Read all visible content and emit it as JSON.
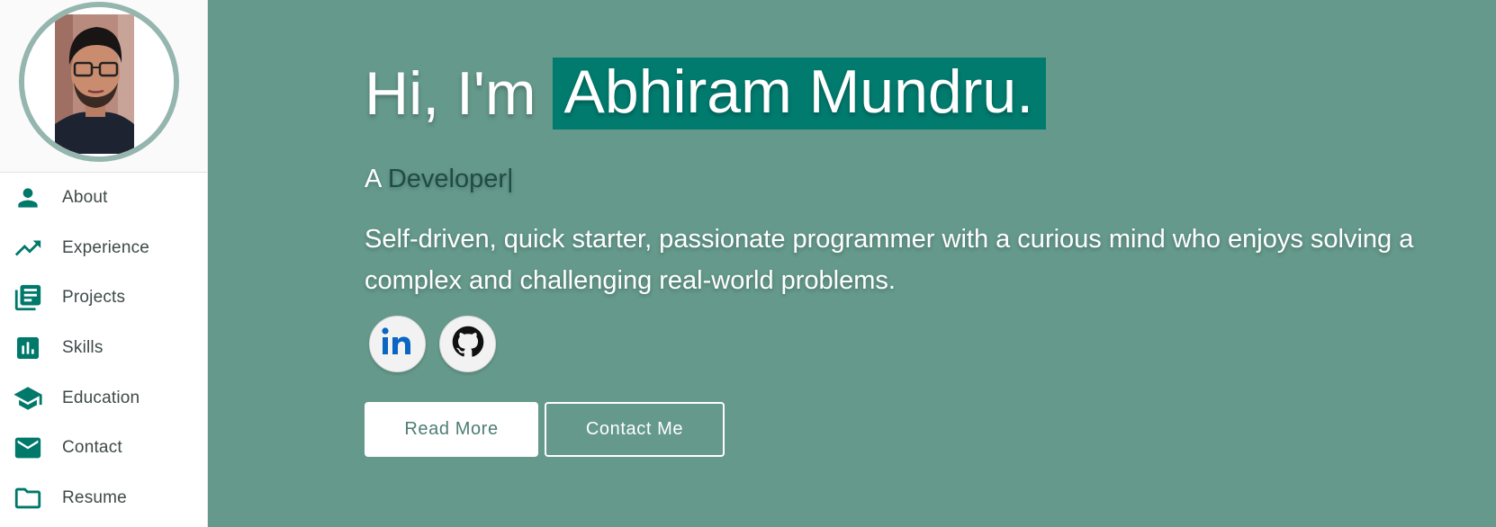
{
  "sidebar": {
    "avatar_alt": "",
    "items": [
      {
        "label": "About",
        "icon": "person-icon"
      },
      {
        "label": "Experience",
        "icon": "trending-up-icon"
      },
      {
        "label": "Projects",
        "icon": "library-books-icon"
      },
      {
        "label": "Skills",
        "icon": "bar-chart-icon"
      },
      {
        "label": "Education",
        "icon": "school-icon"
      },
      {
        "label": "Contact",
        "icon": "mail-icon"
      },
      {
        "label": "Resume",
        "icon": "folder-icon"
      }
    ]
  },
  "hero": {
    "greeting_prefix": "Hi, I'm",
    "name": "Abhiram Mundru.",
    "tagline_prefix": "A",
    "tagline_role": "Developer",
    "cursor": "|",
    "description": "Self-driven, quick starter, passionate programmer with a curious mind who enjoys solving a complex and challenging real-world problems.",
    "socials": [
      {
        "name": "LinkedIn",
        "icon": "linkedin-icon"
      },
      {
        "name": "GitHub",
        "icon": "github-icon"
      }
    ],
    "buttons": {
      "read_more": "Read More",
      "contact_me": "Contact Me"
    }
  },
  "colors": {
    "accent": "#007b6e",
    "hero_bg": "#64998b",
    "icon": "#00796b",
    "avatar_ring": "#95b5af"
  }
}
